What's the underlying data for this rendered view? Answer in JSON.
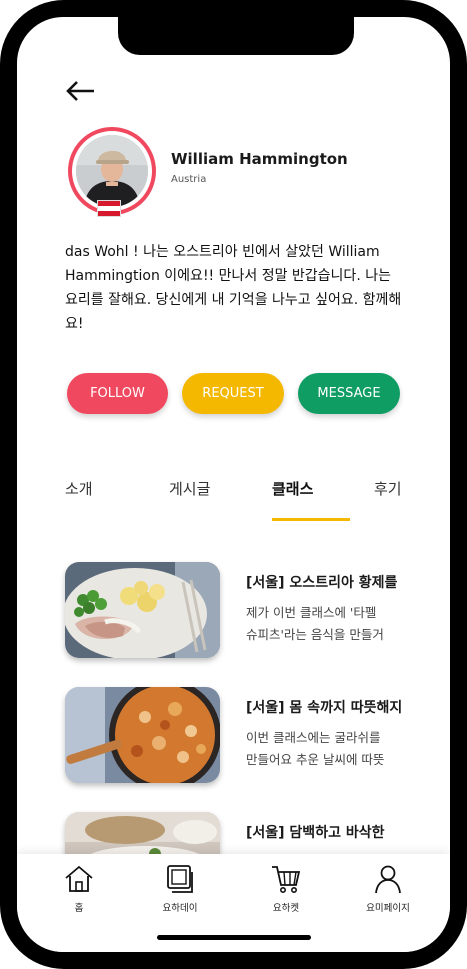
{
  "profile": {
    "name": "William Hammington",
    "country": "Austria",
    "bio": "das Wohl ! 나는 오스트리아 빈에서 살았던 William Hammingtion 이에요!! 만나서 정말 반갑습니다. 나는 요리를 잘해요. 당신에게 내 기억을 나누고 싶어요. 함께해요!"
  },
  "actions": {
    "follow": "FOLLOW",
    "request": "REQUEST",
    "message": "MESSAGE"
  },
  "colors": {
    "follow": "#f0485e",
    "request": "#f5b800",
    "message": "#0f9d63",
    "tab_indicator": "#f5b800"
  },
  "tabs": [
    {
      "label": "소개",
      "active": false
    },
    {
      "label": "게시글",
      "active": false
    },
    {
      "label": "클래스",
      "active": true
    },
    {
      "label": "후기",
      "active": false
    }
  ],
  "classes": [
    {
      "title": "[서울] 오스트리아 황제를",
      "desc_line1": "제가 이번 클래스에 '타펠",
      "desc_line2": "슈피츠'라는 음식을 만들거"
    },
    {
      "title": "[서울] 몸 속까지 따뜻해지",
      "desc_line1": "이번 클래스에는 굴라쉬를",
      "desc_line2": "만들어요 추운 날씨에 따뜻"
    },
    {
      "title": "[서울] 담백하고 바삭한",
      "desc_line1": "",
      "desc_line2": ""
    }
  ],
  "bottom_nav": [
    {
      "label": "홈",
      "icon": "home-icon"
    },
    {
      "label": "요하데이",
      "icon": "photos-icon"
    },
    {
      "label": "요하켓",
      "icon": "cart-icon"
    },
    {
      "label": "요미페이지",
      "icon": "person-icon"
    }
  ]
}
